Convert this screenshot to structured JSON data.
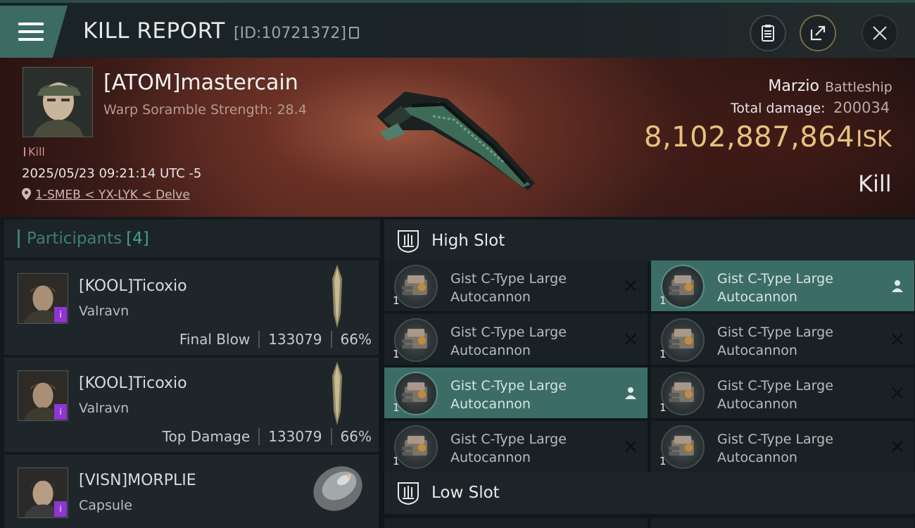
{
  "header": {
    "title": "KILL REPORT",
    "report_id": "[ID:10721372]",
    "icons": [
      "menu-icon",
      "clipboard-icon",
      "share-icon",
      "close-icon"
    ]
  },
  "victim": {
    "name": "[ATOM]mastercain",
    "subtitle": "Warp Soramble Strength: 28.4",
    "tag": "Kill",
    "datetime": "2025/05/23 09:21:14 UTC -5",
    "location": "1-SMEB < YX-LYK < Delve",
    "ship_name": "Marzio",
    "ship_class": "Battleship",
    "total_damage_label": "Total damage:",
    "total_damage": "200034",
    "isk_value": "8,102,887,864",
    "isk_unit": "ISK",
    "result": "Kill"
  },
  "participants": {
    "label": "Participants",
    "count": "[4]",
    "items": [
      {
        "name": "[KOOL]Ticoxio",
        "ship": "Valravn",
        "role": "Final Blow",
        "damage": "133079",
        "percent": "66%"
      },
      {
        "name": "[KOOL]Ticoxio",
        "ship": "Valravn",
        "role": "Top Damage",
        "damage": "133079",
        "percent": "66%"
      },
      {
        "name": "[VISN]MORPLIE",
        "ship": "Capsule"
      }
    ]
  },
  "slots": {
    "high_label": "High Slot",
    "low_label": "Low Slot",
    "high_items": [
      {
        "line1": "Gist C-Type Large",
        "line2": "Autocannon",
        "qty": "1",
        "mark": "x-icon"
      },
      {
        "line1": "Gist C-Type Large",
        "line2": "Autocannon",
        "qty": "1",
        "mark": "person-icon"
      },
      {
        "line1": "Gist C-Type Large",
        "line2": "Autocannon",
        "qty": "1",
        "mark": "x-icon"
      },
      {
        "line1": "Gist C-Type Large",
        "line2": "Autocannon",
        "qty": "1",
        "mark": "x-icon"
      },
      {
        "line1": "Gist C-Type Large",
        "line2": "Autocannon",
        "qty": "1",
        "mark": "person-icon"
      },
      {
        "line1": "Gist C-Type Large",
        "line2": "Autocannon",
        "qty": "1",
        "mark": "x-icon"
      },
      {
        "line1": "Gist C-Type Large",
        "line2": "Autocannon",
        "qty": "1",
        "mark": "x-icon"
      },
      {
        "line1": "Gist C-Type Large",
        "line2": "Autocannon",
        "qty": "1",
        "mark": "x-icon"
      }
    ]
  },
  "colors": {
    "accent_teal": "#3b6d66",
    "isk_gold": "#e8c17d",
    "corp_badge": "#8f35d6"
  }
}
